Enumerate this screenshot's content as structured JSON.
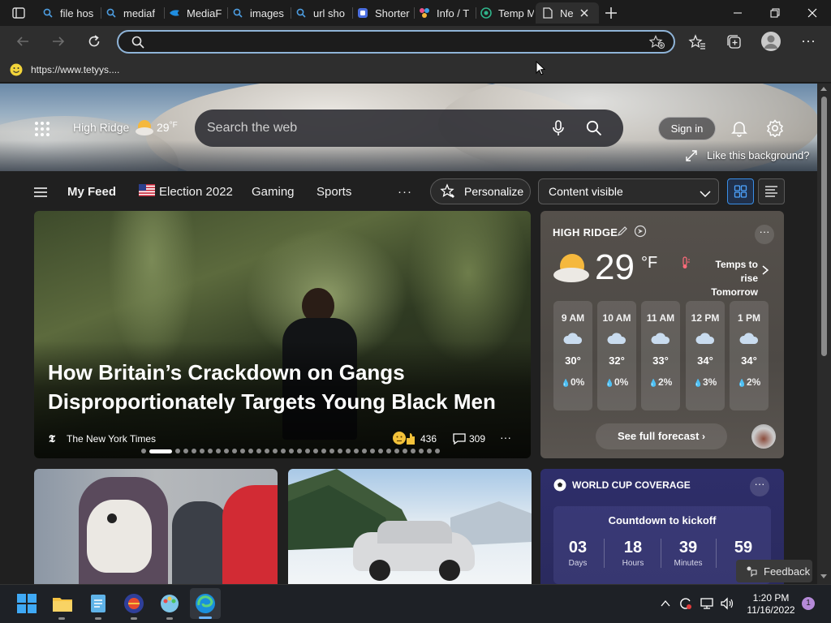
{
  "tabs": [
    {
      "label": "file hos",
      "icon": "search-icon"
    },
    {
      "label": "mediaf",
      "icon": "search-icon"
    },
    {
      "label": "MediaF",
      "icon": "mediafire-icon"
    },
    {
      "label": "images",
      "icon": "search-icon"
    },
    {
      "label": "url sho",
      "icon": "search-icon"
    },
    {
      "label": "Shorter",
      "icon": "shortener-icon"
    },
    {
      "label": "Info / T",
      "icon": "info-icon"
    },
    {
      "label": "Temp M",
      "icon": "tempmail-icon"
    },
    {
      "label": "Ne",
      "icon": "page-icon"
    }
  ],
  "address": {
    "value": "",
    "placeholder": ""
  },
  "favorites": {
    "item": "https://www.tetyys...."
  },
  "header": {
    "location": "High Ridge",
    "temp": "29",
    "unit": "°F",
    "search_placeholder": "Search the web",
    "sign_in": "Sign in",
    "like_bg": "Like this background?"
  },
  "feednav": {
    "my_feed": "My Feed",
    "election": "Election 2022",
    "gaming": "Gaming",
    "sports": "Sports",
    "more": "···",
    "personalize": "Personalize",
    "content_visible": "Content visible"
  },
  "hero_article": {
    "title": "How Britain’s Crackdown on Gangs Disproportionately Targets Young Black Men",
    "source": "The New York Times",
    "reactions": "436",
    "comments": "309",
    "more": "···"
  },
  "weather": {
    "location": "HIGH RIDGE",
    "temp": "29",
    "unit": "°F",
    "note_line1": "Temps to rise",
    "note_line2": "Tomorrow",
    "more": "···",
    "see_full": "See full forecast",
    "hours": [
      {
        "time": "9 AM",
        "temp": "30°",
        "precip": "0%"
      },
      {
        "time": "10 AM",
        "temp": "32°",
        "precip": "0%"
      },
      {
        "time": "11 AM",
        "temp": "33°",
        "precip": "2%"
      },
      {
        "time": "12 PM",
        "temp": "34°",
        "precip": "3%"
      },
      {
        "time": "1 PM",
        "temp": "34°",
        "precip": "2%"
      }
    ]
  },
  "worldcup": {
    "title": "WORLD CUP COVERAGE",
    "countdown_title": "Countdown to kickoff",
    "more": "···",
    "units": [
      {
        "n": "03",
        "u": "Days"
      },
      {
        "n": "18",
        "u": "Hours"
      },
      {
        "n": "39",
        "u": "Minutes"
      },
      {
        "n": "59",
        "u": "Se"
      }
    ]
  },
  "feedback": "Feedback",
  "clock": {
    "time": "1:20 PM",
    "date": "11/16/2022"
  },
  "notification_count": "1",
  "colors": {
    "accent": "#3a8ee6",
    "address_border": "#8fb4d8",
    "weather_card": "#4a4744",
    "worldcup_card": "#2a2a5e"
  }
}
